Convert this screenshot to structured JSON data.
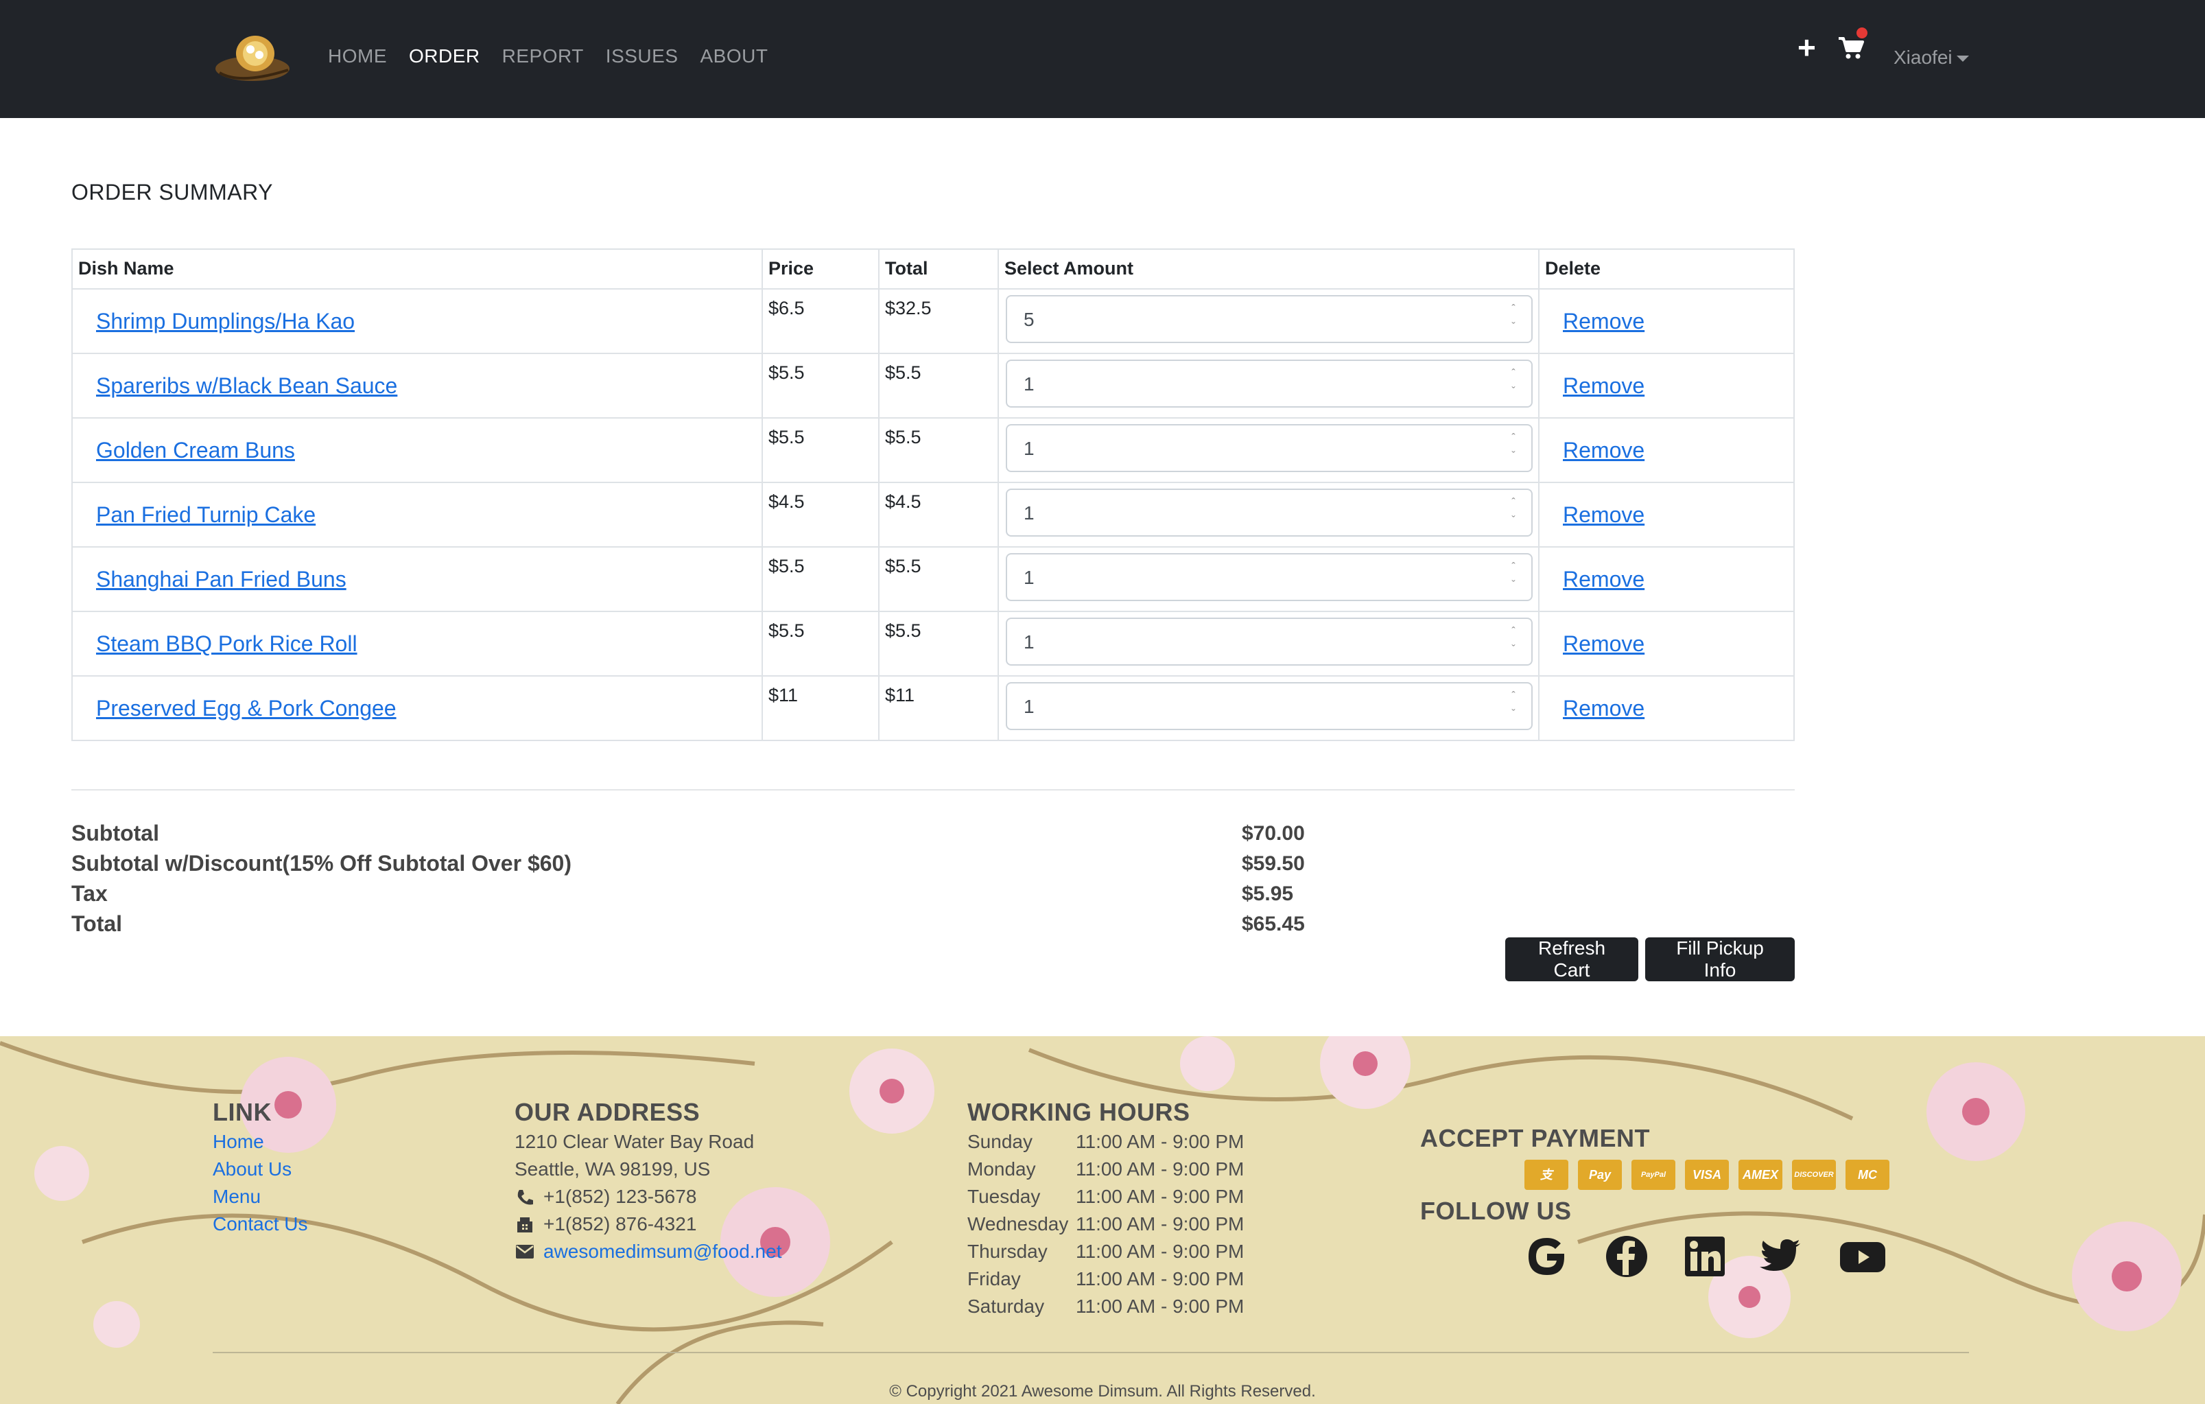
{
  "nav": {
    "links": [
      "HOME",
      "ORDER",
      "REPORT",
      "ISSUES",
      "ABOUT"
    ],
    "active": "ORDER",
    "plus": "+",
    "user": "Xiaofei"
  },
  "order": {
    "title": "ORDER SUMMARY",
    "headers": [
      "Dish Name",
      "Price",
      "Total",
      "Select Amount",
      "Delete"
    ],
    "rows": [
      {
        "name": "Shrimp Dumplings/Ha Kao",
        "price": "$6.5",
        "total": "$32.5",
        "amount": "5",
        "delete": "Remove"
      },
      {
        "name": "Spareribs w/Black Bean Sauce",
        "price": "$5.5",
        "total": "$5.5",
        "amount": "1",
        "delete": "Remove"
      },
      {
        "name": "Golden Cream Buns",
        "price": "$5.5",
        "total": "$5.5",
        "amount": "1",
        "delete": "Remove"
      },
      {
        "name": "Pan Fried Turnip Cake",
        "price": "$4.5",
        "total": "$4.5",
        "amount": "1",
        "delete": "Remove"
      },
      {
        "name": "Shanghai Pan Fried Buns",
        "price": "$5.5",
        "total": "$5.5",
        "amount": "1",
        "delete": "Remove"
      },
      {
        "name": "Steam BBQ Pork Rice Roll",
        "price": "$5.5",
        "total": "$5.5",
        "amount": "1",
        "delete": "Remove"
      },
      {
        "name": "Preserved Egg & Pork Congee",
        "price": "$11",
        "total": "$11",
        "amount": "1",
        "delete": "Remove"
      }
    ]
  },
  "summary": {
    "subtotal_label": "Subtotal",
    "subtotal": "$70.00",
    "discount_label": "Subtotal w/Discount(15% Off Subtotal Over $60)",
    "discount": "$59.50",
    "tax_label": "Tax",
    "tax": "$5.95",
    "total_label": "Total",
    "total": "$65.45"
  },
  "buttons": {
    "refresh": "Refresh Cart",
    "pickup": "Fill Pickup Info"
  },
  "footer": {
    "link_heading": "LINK",
    "links": [
      "Home",
      "About Us",
      "Menu",
      "Contact Us"
    ],
    "address_heading": "OUR ADDRESS",
    "address_line1": "1210 Clear Water Bay Road",
    "address_line2": "Seattle, WA 98199, US",
    "phone": "+1(852) 123-5678",
    "fax": "+1(852) 876-4321",
    "email": "awesomedimsum@food.net",
    "hours_heading": "WORKING HOURS",
    "hours": [
      {
        "day": "Sunday",
        "time": "11:00 AM - 9:00 PM"
      },
      {
        "day": "Monday",
        "time": "11:00 AM - 9:00 PM"
      },
      {
        "day": "Tuesday",
        "time": "11:00 AM - 9:00 PM"
      },
      {
        "day": "Wednesday",
        "time": "11:00 AM - 9:00 PM"
      },
      {
        "day": "Thursday",
        "time": "11:00 AM - 9:00 PM"
      },
      {
        "day": "Friday",
        "time": "11:00 AM - 9:00 PM"
      },
      {
        "day": "Saturday",
        "time": "11:00 AM - 9:00 PM"
      }
    ],
    "payment_heading": "ACCEPT PAYMENT",
    "payment_icons": [
      "alipay-icon",
      "applepay-icon",
      "paypal-icon",
      "visa-icon",
      "amex-icon",
      "discover-icon",
      "mastercard-icon"
    ],
    "payment_labels": [
      "支",
      "Pay",
      "PayPal",
      "VISA",
      "AMEX",
      "DISCOVER",
      "MC"
    ],
    "follow_heading": "FOLLOW US",
    "social_icons": [
      "google-icon",
      "facebook-icon",
      "linkedin-icon",
      "twitter-icon",
      "youtube-icon"
    ],
    "copyright": "© Copyright 2021 Awesome Dimsum. All Rights Reserved."
  },
  "colors": {
    "nav_bg": "#212429",
    "link": "#1a6fe0",
    "button_bg": "#1f2226",
    "footer_bg": "#e9dfb3",
    "payment_icon": "#e2a92a"
  }
}
